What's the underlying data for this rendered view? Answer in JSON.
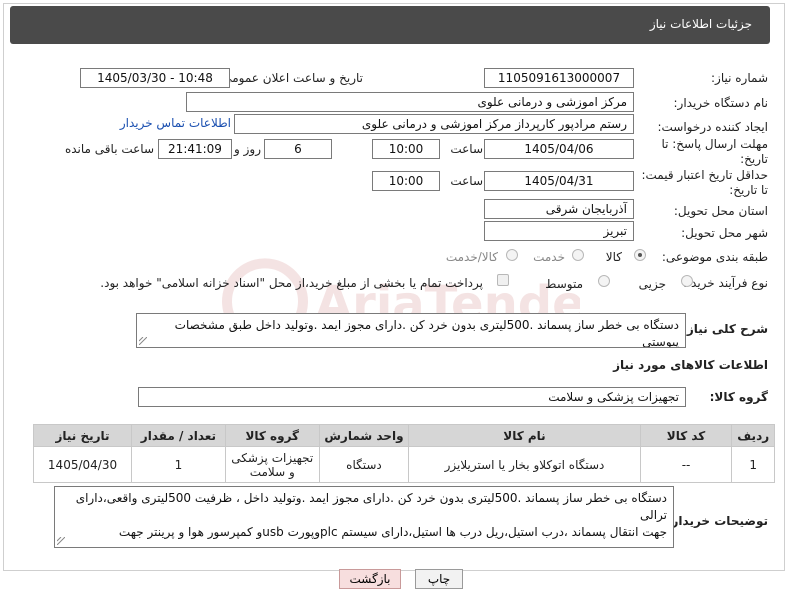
{
  "header": {
    "title": "جزئیات اطلاعات نیاز"
  },
  "fields": {
    "need_number_label": "شماره نیاز:",
    "need_number": "1105091613000007",
    "announce_label": "تاریخ و ساعت اعلان عمومی:",
    "announce_value": "1405/03/30 - 10:48",
    "buyer_org_label": "نام دستگاه خریدار:",
    "buyer_org": "مرکز اموزشی و درمانی علوی",
    "creator_label": "ایجاد کننده درخواست:",
    "creator": "رستم مرادپور کارپرداز  مرکز اموزشی و درمانی علوی",
    "contact_link": "اطلاعات تماس خریدار",
    "deadline_label_1": "مهلت ارسال پاسخ: تا",
    "deadline_label_2": "تاریخ:",
    "deadline_date": "1405/04/06",
    "time_label": "ساعت",
    "deadline_time": "10:00",
    "days_value": "6",
    "days_label": "روز و",
    "remaining_time": "21:41:09",
    "remaining_label": "ساعت باقی مانده",
    "min_price_label_1": "حداقل تاریخ اعتبار قیمت:",
    "min_price_label_2": "تا تاریخ:",
    "min_price_date": "1405/04/31",
    "min_price_time": "10:00",
    "province_label": "استان محل تحویل:",
    "province": "آذربایجان شرقی",
    "city_label": "شهر محل تحویل:",
    "city": "تبریز",
    "category_label": "طبقه بندی موضوعی:",
    "category_options": [
      "کالا",
      "خدمت",
      "کالا/خدمت"
    ],
    "process_label": "نوع فرآیند خرید :",
    "process_options": [
      "جزیی",
      "متوسط"
    ],
    "payment_note": "پرداخت تمام یا بخشی از مبلغ خرید،از محل \"اسناد خزانه اسلامی\" خواهد بود."
  },
  "description": {
    "label": "شرح کلی نیاز:",
    "text": "دستگاه بی خطر ساز پسماند .500لیتری بدون خرد کن .دارای مجوز ایمد .وتولید داخل طبق مشخصات پیوستی"
  },
  "goods_info": {
    "title": "اطلاعات کالاهای مورد نیاز",
    "group_label": "گروه کالا:",
    "group_value": "تجهیزات پزشکی و سلامت"
  },
  "table": {
    "headers": [
      "ردیف",
      "کد کالا",
      "نام کالا",
      "واحد شمارش",
      "گروه کالا",
      "تعداد / مقدار",
      "تاریخ نیاز"
    ],
    "rows": [
      [
        "1",
        "--",
        "دستگاه اتوکلاو بخار یا استریلایزر",
        "دستگاه",
        "تجهیزات پزشکی و سلامت",
        "1",
        "1405/04/30"
      ]
    ]
  },
  "buyer_notes": {
    "label": "توضیحات خریدار:",
    "line1": "دستگاه بی خطر ساز پسماند .500لیتری بدون خرد کن .دارای مجوز ایمد .وتولید داخل ، ظرفیت 500لیتری واقعی،دارای ترالی",
    "line2": "جهت انتقال پسماند ،درب استیل،ریل درب  ها استیل،دارای سیستم plcوپورت usbو کمپرسور هوا و پرینتر جهت"
  },
  "buttons": {
    "print": "چاپ",
    "back": "بازگشت"
  },
  "watermark_text": "AriaTender.net",
  "colors": {
    "header_bg": "#4a4a4a",
    "link": "#1a4fb0",
    "back_button_bg": "#f7dede"
  }
}
